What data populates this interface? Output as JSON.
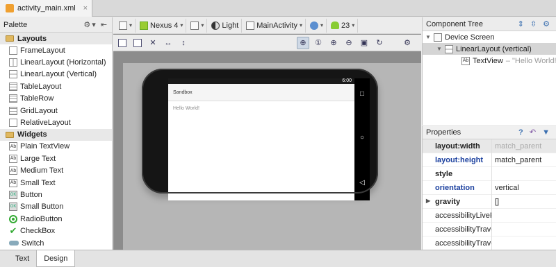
{
  "editor_tab": {
    "file_name": "activity_main.xml",
    "close": "×"
  },
  "palette": {
    "title": "Palette",
    "groups": [
      {
        "label": "Layouts",
        "items": [
          "FrameLayout",
          "LinearLayout (Horizontal)",
          "LinearLayout (Vertical)",
          "TableLayout",
          "TableRow",
          "GridLayout",
          "RelativeLayout"
        ]
      },
      {
        "label": "Widgets",
        "items": [
          "Plain TextView",
          "Large Text",
          "Medium Text",
          "Small Text",
          "Button",
          "Small Button",
          "RadioButton",
          "CheckBox",
          "Switch"
        ]
      }
    ]
  },
  "toolbar": {
    "device": "Nexus 4",
    "theme": "Light",
    "activity": "MainActivity",
    "api_level": "23"
  },
  "device_preview": {
    "status_time": "6:00",
    "app_title": "Sandbox",
    "text_view": "Hello World!"
  },
  "component_tree": {
    "title": "Component Tree",
    "nodes": [
      {
        "label": "Device Screen"
      },
      {
        "label": "LinearLayout (vertical)"
      },
      {
        "label": "TextView",
        "hint": " – \"Hello World!\""
      }
    ]
  },
  "properties": {
    "title": "Properties",
    "rows": [
      {
        "name": "layout:width",
        "value": "match_parent"
      },
      {
        "name": "layout:height",
        "value": "match_parent"
      },
      {
        "name": "style",
        "value": ""
      },
      {
        "name": "orientation",
        "value": "vertical"
      },
      {
        "name": "gravity",
        "value": "[]"
      },
      {
        "name": "accessibilityLiveRegion",
        "value": ""
      },
      {
        "name": "accessibilityTraversalAfter",
        "value": ""
      },
      {
        "name": "accessibilityTraversalBefore",
        "value": ""
      }
    ]
  },
  "bottom_tabs": [
    "Text",
    "Design"
  ],
  "icons": {
    "palette_settings": "gear-icon",
    "palette_collapse": "collapse-icon",
    "tree_expand": "expand-all-icon",
    "tree_collapse": "collapse-all-icon",
    "props_help": "help-icon",
    "props_undo": "undo-icon",
    "props_filter": "filter-icon"
  }
}
